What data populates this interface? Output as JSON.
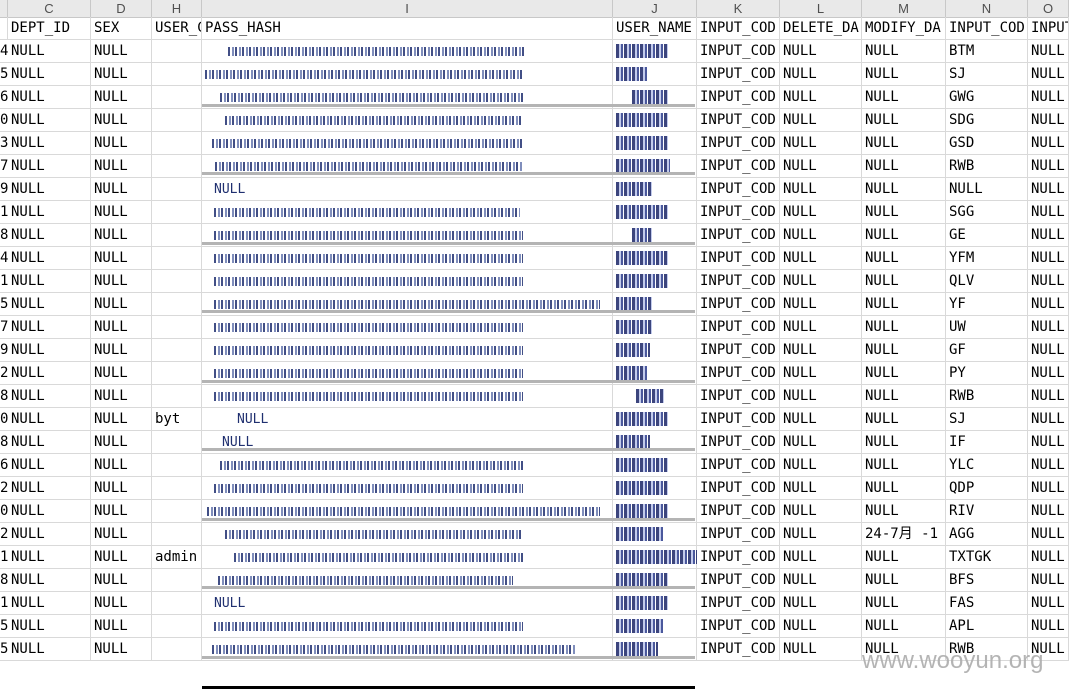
{
  "column_letters": [
    "C",
    "D",
    "H",
    "I",
    "J",
    "K",
    "L",
    "M",
    "N",
    "O"
  ],
  "headers": [
    "DEPT_ID",
    "SEX",
    "USER_CODE",
    "PASS_HASH",
    "USER_NAME",
    "INPUT_COD",
    "DELETE_DA",
    "MODIFY_DA",
    "INPUT_COD",
    "INPUT"
  ],
  "rows": [
    {
      "rn": "4",
      "dept": "NULL",
      "sex": "NULL",
      "code": "",
      "hashpre": "",
      "name": "",
      "input1": "INPUT_COD",
      "del": "NULL",
      "mod": "NULL",
      "input2": "BTM",
      "input3": "NULL"
    },
    {
      "rn": "5",
      "dept": "NULL",
      "sex": "NULL",
      "code": "",
      "hashpre": "",
      "name": "",
      "input1": "INPUT_COD",
      "del": "NULL",
      "mod": "NULL",
      "input2": "SJ",
      "input3": "NULL"
    },
    {
      "rn": "6",
      "dept": "NULL",
      "sex": "NULL",
      "code": "",
      "hashpre": "",
      "name": "",
      "input1": "INPUT_COD",
      "del": "NULL",
      "mod": "NULL",
      "input2": "GWG",
      "input3": "NULL"
    },
    {
      "rn": "0",
      "dept": "NULL",
      "sex": "NULL",
      "code": "",
      "hashpre": "",
      "name": "",
      "input1": "INPUT_COD",
      "del": "NULL",
      "mod": "NULL",
      "input2": "SDG",
      "input3": "NULL"
    },
    {
      "rn": "3",
      "dept": "NULL",
      "sex": "NULL",
      "code": "",
      "hashpre": "",
      "name": "",
      "input1": "INPUT_COD",
      "del": "NULL",
      "mod": "NULL",
      "input2": "GSD",
      "input3": "NULL"
    },
    {
      "rn": "7",
      "dept": "NULL",
      "sex": "NULL",
      "code": "",
      "hashpre": "",
      "name": "",
      "input1": "INPUT_COD",
      "del": "NULL",
      "mod": "NULL",
      "input2": "RWB",
      "input3": "NULL"
    },
    {
      "rn": "9",
      "dept": "NULL",
      "sex": "NULL",
      "code": "",
      "hashpre": "NULL",
      "name": "",
      "input1": "INPUT_COD",
      "del": "NULL",
      "mod": "NULL",
      "input2": "NULL",
      "input3": "NULL"
    },
    {
      "rn": "1",
      "dept": "NULL",
      "sex": "NULL",
      "code": "",
      "hashpre": "",
      "name": "",
      "input1": "INPUT_COD",
      "del": "NULL",
      "mod": "NULL",
      "input2": "SGG",
      "input3": "NULL"
    },
    {
      "rn": "8",
      "dept": "NULL",
      "sex": "NULL",
      "code": "",
      "hashpre": "",
      "name": "",
      "input1": "INPUT_COD",
      "del": "NULL",
      "mod": "NULL",
      "input2": "GE",
      "input3": "NULL"
    },
    {
      "rn": "4",
      "dept": "NULL",
      "sex": "NULL",
      "code": "",
      "hashpre": "",
      "name": "",
      "input1": "INPUT_COD",
      "del": "NULL",
      "mod": "NULL",
      "input2": "YFM",
      "input3": "NULL"
    },
    {
      "rn": "1",
      "dept": "NULL",
      "sex": "NULL",
      "code": "",
      "hashpre": "",
      "name": "",
      "input1": "INPUT_COD",
      "del": "NULL",
      "mod": "NULL",
      "input2": "QLV",
      "input3": "NULL"
    },
    {
      "rn": "5",
      "dept": "NULL",
      "sex": "NULL",
      "code": "",
      "hashpre": "",
      "name": "",
      "input1": "INPUT_COD",
      "del": "NULL",
      "mod": "NULL",
      "input2": "YF",
      "input3": "NULL"
    },
    {
      "rn": "7",
      "dept": "NULL",
      "sex": "NULL",
      "code": "",
      "hashpre": "",
      "name": "",
      "input1": "INPUT_COD",
      "del": "NULL",
      "mod": "NULL",
      "input2": "UW",
      "input3": "NULL"
    },
    {
      "rn": "9",
      "dept": "NULL",
      "sex": "NULL",
      "code": "",
      "hashpre": "",
      "name": "",
      "input1": "INPUT_COD",
      "del": "NULL",
      "mod": "NULL",
      "input2": "GF",
      "input3": "NULL"
    },
    {
      "rn": "2",
      "dept": "NULL",
      "sex": "NULL",
      "code": "",
      "hashpre": "",
      "name": "",
      "input1": "INPUT_COD",
      "del": "NULL",
      "mod": "NULL",
      "input2": "PY",
      "input3": "NULL"
    },
    {
      "rn": "8",
      "dept": "NULL",
      "sex": "NULL",
      "code": "",
      "hashpre": "",
      "name": "",
      "input1": "INPUT_COD",
      "del": "NULL",
      "mod": "NULL",
      "input2": "RWB",
      "input3": "NULL"
    },
    {
      "rn": "0",
      "dept": "NULL",
      "sex": "NULL",
      "code": "byt",
      "hashpre": "NULL",
      "name": "",
      "input1": "INPUT_COD",
      "del": "NULL",
      "mod": "NULL",
      "input2": "SJ",
      "input3": "NULL"
    },
    {
      "rn": "8",
      "dept": "NULL",
      "sex": "NULL",
      "code": "",
      "hashpre": "NULL",
      "name": "",
      "input1": "INPUT_COD",
      "del": "NULL",
      "mod": "NULL",
      "input2": "IF",
      "input3": "NULL"
    },
    {
      "rn": "6",
      "dept": "NULL",
      "sex": "NULL",
      "code": "",
      "hashpre": "",
      "name": "",
      "input1": "INPUT_COD",
      "del": "NULL",
      "mod": "NULL",
      "input2": "YLC",
      "input3": "NULL"
    },
    {
      "rn": "2",
      "dept": "NULL",
      "sex": "NULL",
      "code": "",
      "hashpre": "",
      "name": "",
      "input1": "INPUT_COD",
      "del": "NULL",
      "mod": "NULL",
      "input2": "QDP",
      "input3": "NULL"
    },
    {
      "rn": "0",
      "dept": "NULL",
      "sex": "NULL",
      "code": "",
      "hashpre": "",
      "name": "",
      "input1": "INPUT_COD",
      "del": "NULL",
      "mod": "NULL",
      "input2": "RIV",
      "input3": "NULL"
    },
    {
      "rn": "2",
      "dept": "NULL",
      "sex": "NULL",
      "code": "",
      "hashpre": "",
      "name": "",
      "input1": "INPUT_COD",
      "del": "NULL",
      "mod": "24-7月 -1",
      "input2": "AGG",
      "input3": "NULL"
    },
    {
      "rn": "1",
      "dept": "NULL",
      "sex": "NULL",
      "code": "admin",
      "hashpre": "",
      "name": "",
      "input1": "INPUT_COD",
      "del": "NULL",
      "mod": "NULL",
      "input2": "TXTGK",
      "input3": "NULL"
    },
    {
      "rn": "8",
      "dept": "NULL",
      "sex": "NULL",
      "code": "",
      "hashpre": "",
      "name": "",
      "input1": "INPUT_COD",
      "del": "NULL",
      "mod": "NULL",
      "input2": "BFS",
      "input3": "NULL"
    },
    {
      "rn": "1",
      "dept": "NULL",
      "sex": "NULL",
      "code": "",
      "hashpre": "NULL",
      "name": "",
      "input1": "INPUT_COD",
      "del": "NULL",
      "mod": "NULL",
      "input2": "FAS",
      "input3": "NULL"
    },
    {
      "rn": "5",
      "dept": "NULL",
      "sex": "NULL",
      "code": "",
      "hashpre": "",
      "name": "",
      "input1": "INPUT_COD",
      "del": "NULL",
      "mod": "NULL",
      "input2": "APL",
      "input3": "NULL"
    },
    {
      "rn": "5",
      "dept": "NULL",
      "sex": "NULL",
      "code": "",
      "hashpre": "",
      "name": "",
      "input1": "INPUT_COD",
      "del": "NULL",
      "mod": "NULL",
      "input2": "RWB",
      "input3": "NULL"
    }
  ],
  "watermark": "www.wooyun.org"
}
